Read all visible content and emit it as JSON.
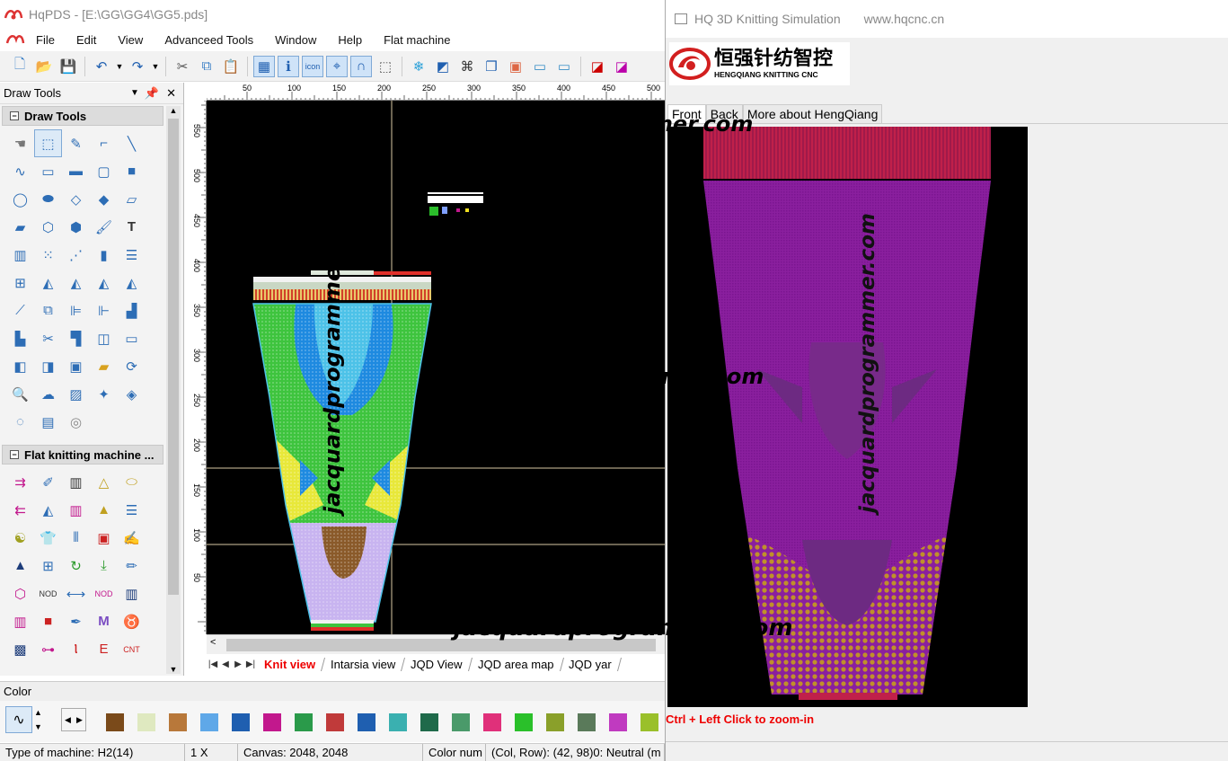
{
  "window": {
    "title": "HqPDS - [E:\\GG\\GG4\\GG5.pds]"
  },
  "menu": [
    "File",
    "Edit",
    "View",
    "Advanceed Tools",
    "Window",
    "Help",
    "Flat machine"
  ],
  "left_panel": {
    "title": "Draw Tools",
    "sections": [
      {
        "label": "Draw Tools"
      },
      {
        "label": "Flat knitting machine ..."
      }
    ]
  },
  "ruler": {
    "h_ticks": [
      "50",
      "100",
      "150",
      "200",
      "250",
      "300",
      "350",
      "400",
      "450",
      "500"
    ],
    "v_ticks": [
      "550",
      "500",
      "450",
      "400",
      "350",
      "300",
      "250",
      "200",
      "150",
      "100",
      "50"
    ]
  },
  "view_tabs": [
    "Knit view",
    "Intarsia view",
    "JQD View",
    "JQD area map",
    "JQD yar"
  ],
  "active_tab": "Knit view",
  "color_panel": {
    "label": "Color"
  },
  "status": {
    "machine": "Type of machine: H2(14)",
    "zoom": "1 X",
    "canvas": "Canvas: 2048, 2048",
    "colornum": "Color num",
    "position": "(Col, Row): (42, 98)0: Neutral (m"
  },
  "watermark": "jacquardprogrammer.com",
  "simulation": {
    "title": "HQ 3D Knitting Simulation",
    "url": "www.hqcnc.cn",
    "logo_cn": "恒强针纺智控",
    "logo_en": "HENGQIANG KNITTING CNC",
    "tabs": [
      "Front",
      "Back",
      "More about HengQiang"
    ],
    "hint": "Ctrl + Left Click to zoom-in"
  },
  "colors": {
    "accent": "#2d6db5",
    "active_tab": "#ee0000",
    "garment_main": "#8a1f9e"
  }
}
